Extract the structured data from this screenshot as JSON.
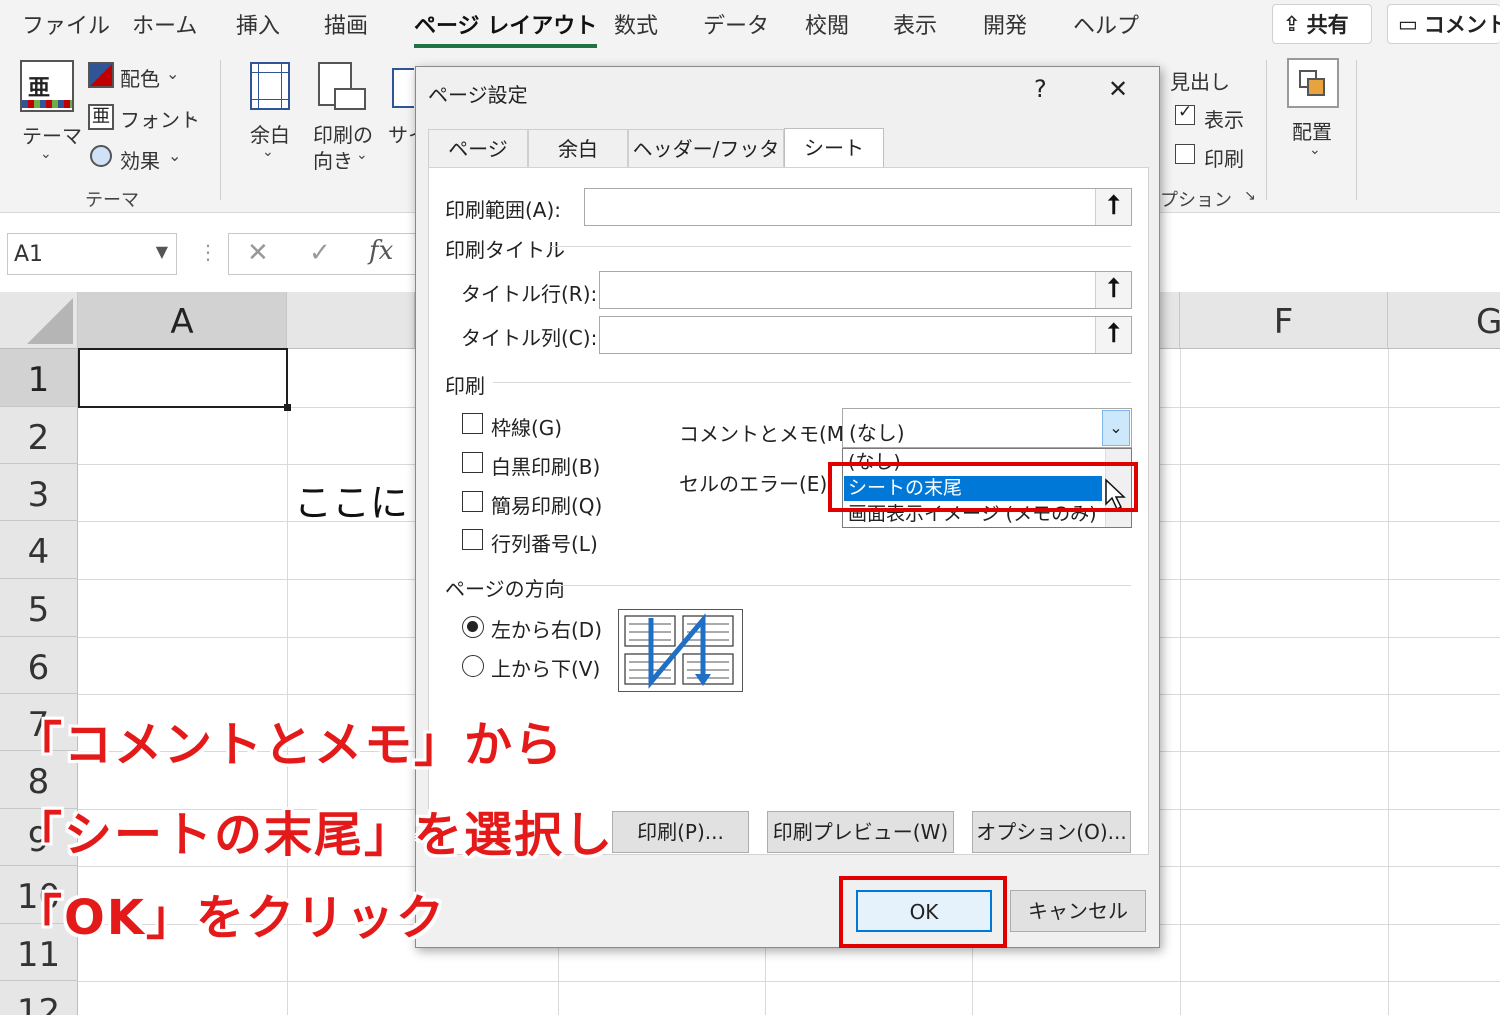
{
  "menu": {
    "tabs": [
      "ファイル",
      "ホーム",
      "挿入",
      "描画",
      "ページ レイアウト",
      "数式",
      "データ",
      "校閲",
      "表示",
      "開発",
      "ヘルプ"
    ],
    "active_tab": "ページ レイアウト",
    "share_label": "共有",
    "comment_label": "コメント"
  },
  "ribbon": {
    "theme_label": "テーマ",
    "theme_group_label": "テーマ",
    "colors_label": "配色",
    "fonts_label": "フォント",
    "effects_label": "効果",
    "margins_label": "余白",
    "orientation_label_1": "印刷の",
    "orientation_label_2": "向き",
    "size_label_partial": "サイ",
    "headings_label": "見出し",
    "view_label": "表示",
    "print_label": "印刷",
    "sheet_options_label_partial": "プション",
    "arrange_label": "配置"
  },
  "formula_bar": {
    "name_box": "A1",
    "fx": "fx"
  },
  "grid": {
    "columns": [
      "A",
      "F",
      "G"
    ],
    "rows": [
      "1",
      "2",
      "3",
      "4",
      "5",
      "6",
      "7",
      "8",
      "9",
      "10",
      "11",
      "12"
    ],
    "cell_b3_partial": "ここに"
  },
  "dialog": {
    "title": "ページ設定",
    "help": "?",
    "close": "✕",
    "tabs": [
      "ページ",
      "余白",
      "ヘッダー/フッター",
      "シート"
    ],
    "active_tab": "シート",
    "print_area_label": "印刷範囲(A):",
    "print_titles_label": "印刷タイトル",
    "title_rows_label": "タイトル行(R):",
    "title_cols_label": "タイトル列(C):",
    "print_section_label": "印刷",
    "gridlines_label": "枠線(G)",
    "bw_label": "白黒印刷(B)",
    "draft_label": "簡易印刷(Q)",
    "row_col_headings_label": "行列番号(L)",
    "comments_label": "コメントとメモ(M):",
    "comments_value": "(なし)",
    "cell_errors_label": "セルのエラー(E):",
    "comments_options": [
      "(なし)",
      "シートの末尾",
      "画面表示イメージ (メモのみ)"
    ],
    "selected_option": "シートの末尾",
    "page_order_label": "ページの方向",
    "down_then_over_label": "左から右(D)",
    "over_then_down_label": "上から下(V)",
    "print_btn": "印刷(P)...",
    "preview_btn": "印刷プレビュー(W)",
    "options_btn": "オプション(O)...",
    "ok_btn": "OK",
    "cancel_btn": "キャンセル"
  },
  "annotation": {
    "line1": "「コメントとメモ」から",
    "line2": "「シートの末尾」を選択し",
    "line3": "「OK」をクリック",
    "highlight_color": "#e00000"
  }
}
